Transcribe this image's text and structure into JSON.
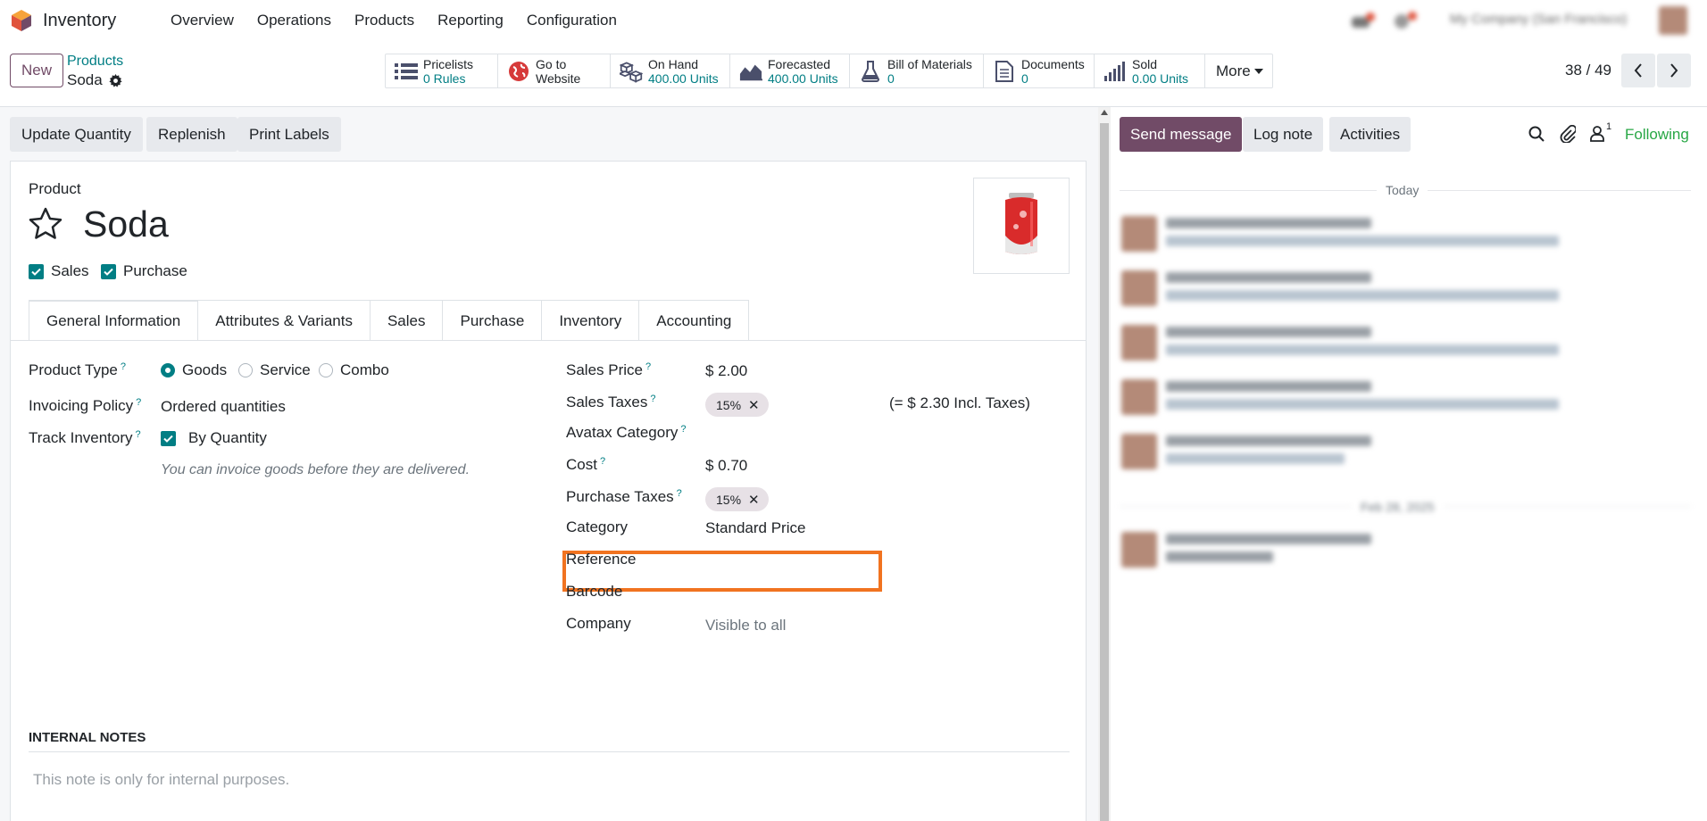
{
  "app": {
    "name": "Inventory",
    "menu": [
      "Overview",
      "Operations",
      "Products",
      "Reporting",
      "Configuration"
    ],
    "company_name": "My Company (San Francisco)",
    "brand_color": "#714b67",
    "accent_color": "#017e84"
  },
  "control": {
    "new_label": "New",
    "breadcrumb_parent": "Products",
    "breadcrumb_current": "Soda",
    "more_label": "More",
    "pager": "38 / 49"
  },
  "stats": [
    {
      "icon": "list-icon",
      "line1": "Pricelists",
      "line2": "0  Rules"
    },
    {
      "icon": "globe-icon",
      "line1": "Go to",
      "line2": "Website"
    },
    {
      "icon": "cubes-icon",
      "line1": "On Hand",
      "line2": "400.00 Units"
    },
    {
      "icon": "area-chart-icon",
      "line1": "Forecasted",
      "line2": "400.00 Units"
    },
    {
      "icon": "flask-icon",
      "line1": "Bill of Materials",
      "line2": "0"
    },
    {
      "icon": "document-icon",
      "line1": "Documents",
      "line2": "0"
    },
    {
      "icon": "bar-chart-icon",
      "line1": "Sold",
      "line2": "0.00 Units"
    }
  ],
  "actions": {
    "update_quantity": "Update Quantity",
    "replenish": "Replenish",
    "print_labels": "Print Labels"
  },
  "product": {
    "label": "Product",
    "name": "Soda",
    "sales_checkbox": "Sales",
    "purchase_checkbox": "Purchase"
  },
  "tabs": [
    "General Information",
    "Attributes & Variants",
    "Sales",
    "Purchase",
    "Inventory",
    "Accounting"
  ],
  "general": {
    "product_type_label": "Product Type",
    "product_type_options": [
      "Goods",
      "Service",
      "Combo"
    ],
    "invoicing_policy_label": "Invoicing Policy",
    "invoicing_policy_value": "Ordered quantities",
    "track_inventory_label": "Track Inventory",
    "track_inventory_value": "By Quantity",
    "invoice_hint": "You can invoice goods before they are delivered.",
    "sales_price_label": "Sales Price",
    "sales_price_value": "$ 2.00",
    "sales_taxes_label": "Sales Taxes",
    "sales_taxes_tag": "15%",
    "sales_taxes_incl": "(= $ 2.30 Incl. Taxes)",
    "avatax_label": "Avatax Category",
    "cost_label": "Cost",
    "cost_value": "$ 0.70",
    "purchase_taxes_label": "Purchase Taxes",
    "purchase_taxes_tag": "15%",
    "category_label": "Category",
    "category_value": "Standard Price",
    "reference_label": "Reference",
    "barcode_label": "Barcode",
    "company_label": "Company",
    "company_placeholder": "Visible to all",
    "internal_notes_title": "INTERNAL NOTES",
    "internal_notes_placeholder": "This note is only for internal purposes."
  },
  "chatter": {
    "send_message": "Send message",
    "log_note": "Log note",
    "activities": "Activities",
    "followers_count": "1",
    "following": "Following",
    "today": "Today",
    "older_date": "Feb 28, 2025",
    "highlight_color": "#f17320"
  }
}
